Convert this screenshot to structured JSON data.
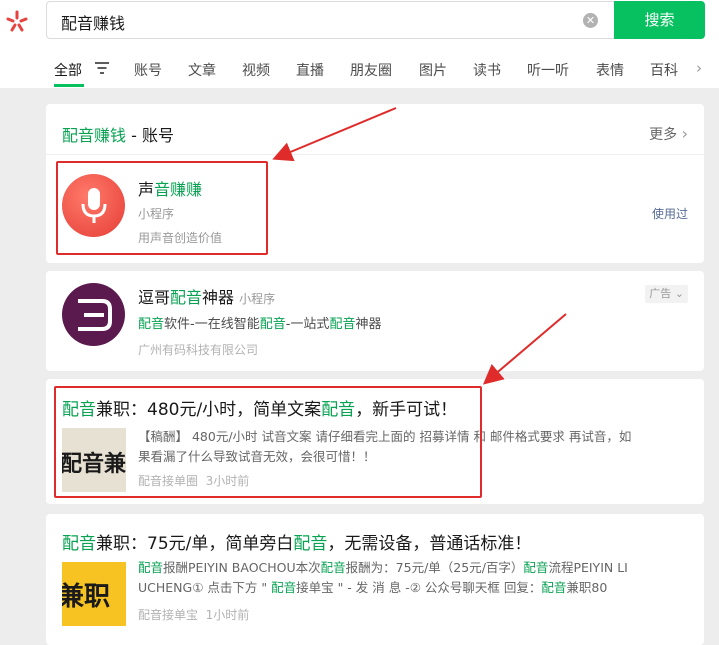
{
  "search": {
    "query": "配音赚钱",
    "button": "搜索"
  },
  "tabs": [
    "全部",
    "账号",
    "文章",
    "视频",
    "直播",
    "朋友圈",
    "图片",
    "读书",
    "听一听",
    "表情",
    "百科"
  ],
  "account_section": {
    "title_hl": "配音赚钱",
    "title_rest": " - 账号",
    "more": "更多",
    "item": {
      "name_a": "声",
      "name_b": "音赚赚",
      "type": "小程序",
      "desc": "用声音创造价值",
      "status": "使用过"
    }
  },
  "ad_card": {
    "t1": "逗哥",
    "t2": "配音",
    "t3": "神器",
    "type": "小程序",
    "badge": "广告",
    "d1": "配音",
    "d2": "软件-一在线智能",
    "d3": "配音",
    "d4": "-一站式",
    "d5": "配音",
    "d6": "神器",
    "company": "广州有码科技有限公司"
  },
  "article1": {
    "t1": "配音",
    "t2": "兼职：480元/小时，简单文案",
    "t3": "配音",
    "t4": "，新手可试！",
    "thumb": "配音兼职",
    "line1": "【稿酬】 480元/小时 试音文案 请仔细看完上面的 招募详情 和 邮件格式要求 再试音，如",
    "line2": "果看漏了什么导致试音无效，会很可惜！！",
    "source": "配音接单圈",
    "time": "3小时前"
  },
  "article2": {
    "t1": "配音",
    "t2": "兼职：75元/单，简单旁白",
    "t3": "配音",
    "t4": "，无需设备，普通话标准！",
    "thumb": "兼职",
    "l1a": "配音",
    "l1b": "报酬PEIYIN BAOCHOU本次",
    "l1c": "配音",
    "l1d": "报酬为：75元/单（25元/百字）",
    "l1e": "配音",
    "l1f": "流程PEIYIN LI",
    "l2a": "UCHENG① 点击下方 \" ",
    "l2b": "配音",
    "l2c": "接单宝 \" - 发 消 息 -② 公众号聊天框 回复：",
    "l2d": "配音",
    "l2e": "兼职80",
    "source": "配音接单宝",
    "time": "1小时前"
  }
}
